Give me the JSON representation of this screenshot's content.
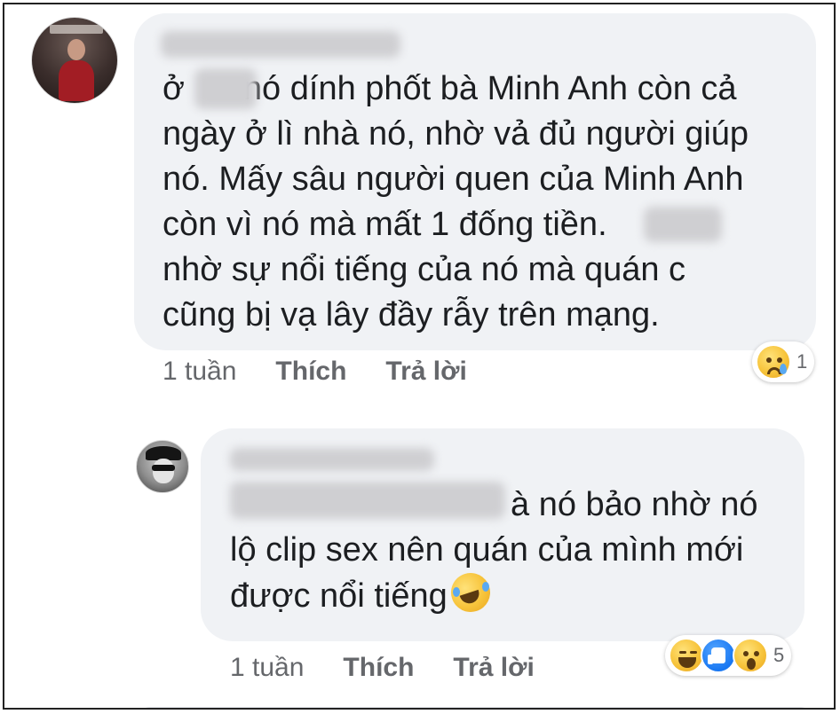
{
  "comments": [
    {
      "author_name": "",
      "text_lines": [
        "nó dính phốt bà Minh Anh còn cả",
        "ngày ở lì nhà nó, nhờ vả đủ người giúp",
        "nó. Mấy sâu người quen của Minh Anh",
        "còn vì nó mà mất 1 đống tiền.",
        "nhờ sự nổi tiếng của nó mà quán c",
        "cũng bị vạ lây đầy rẫy trên mạng."
      ],
      "text_prefix": "ở",
      "time": "1 tuần",
      "like_label": "Thích",
      "reply_label": "Trả lời",
      "reactions": [
        "crying-face",
        "sad"
      ],
      "reaction_count": "1"
    },
    {
      "author_name": "",
      "text_lines": [
        "à nó bảo nhờ nó",
        "lộ clip sex nên quán của mình mới",
        "được nổi tiếng"
      ],
      "trailing_emoji": "rolling-on-floor-laughing",
      "time": "1 tuần",
      "like_label": "Thích",
      "reply_label": "Trả lời",
      "reactions": [
        "haha",
        "like",
        "wow"
      ],
      "reaction_count": "5"
    }
  ],
  "colors": {
    "bubble": "#f0f2f5",
    "text": "#1c1e21",
    "meta": "#65676b",
    "like_blue": "#1877f2"
  }
}
